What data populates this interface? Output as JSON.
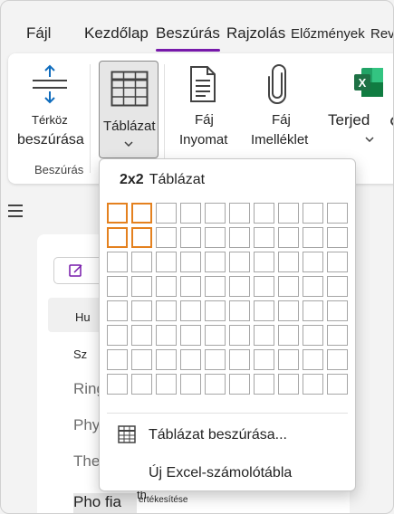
{
  "tabs": [
    {
      "label": "Fájl"
    },
    {
      "label": "Kezdőlap"
    },
    {
      "label": "Beszúrás"
    },
    {
      "label": "Rajzolás"
    },
    {
      "label": "Előzmények"
    },
    {
      "label": "Rev"
    }
  ],
  "ribbon": {
    "spacing_label_1": "Térköz",
    "spacing_label_2": "beszúrása",
    "group_label": "Beszúrás",
    "table_label": "Táblázat",
    "file_print_1": "Fáj",
    "file_print_2": "Inyomat",
    "file_attach_1": "Fáj",
    "file_attach_2": "Imelléklet",
    "embedded_label": "Terjed",
    "accent_color": "#7719aa",
    "excel_color": "#1e7145"
  },
  "page": {
    "row_1": "Hu",
    "row_2": "Sz",
    "row_3": "Ring",
    "row_4": "Phy",
    "row_5": "The",
    "row_6": "Pho fia",
    "row_7": "th",
    "row_8": "értékesítése"
  },
  "dropdown": {
    "size_label": "2x2",
    "title": "Táblázat",
    "grid_cols": 10,
    "grid_rows": 8,
    "selected_cols": 2,
    "selected_rows": 2,
    "selection_color": "#e4811f",
    "insert_table": "Táblázat beszúrása...",
    "new_excel": "Új Excel-számolótábla"
  }
}
